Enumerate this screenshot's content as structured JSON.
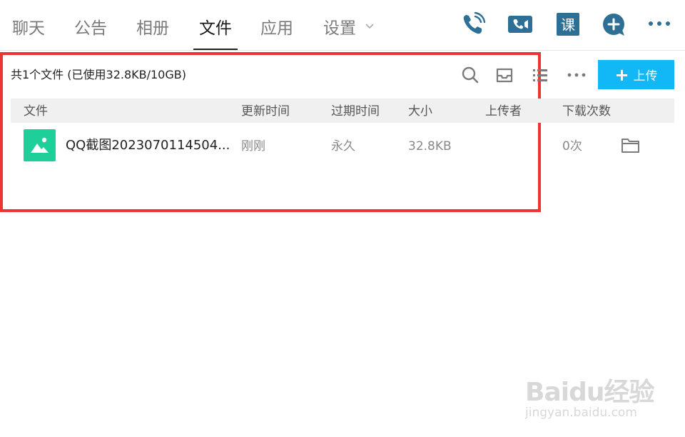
{
  "tabs": [
    {
      "label": "聊天"
    },
    {
      "label": "公告"
    },
    {
      "label": "相册"
    },
    {
      "label": "文件",
      "active": true
    },
    {
      "label": "应用"
    },
    {
      "label": "设置"
    }
  ],
  "toolbar_icons": [
    "phone-call-icon",
    "video-call-icon",
    "course-icon",
    "add-circle-icon",
    "more-icon"
  ],
  "course_icon_char": "课",
  "files": {
    "summary": "共1个文件 (已使用32.8KB/10GB)",
    "upload_label": "上传",
    "columns": [
      "文件",
      "更新时间",
      "过期时间",
      "大小",
      "上传者",
      "下载次数"
    ],
    "rows": [
      {
        "name": "QQ截图2023070114504...",
        "updated": "刚刚",
        "expires": "永久",
        "size": "32.8KB",
        "uploader": "",
        "downloads": "0次"
      }
    ]
  },
  "watermark": {
    "main": "Baidu经验",
    "sub": "jingyan.baidu.com"
  },
  "colors": {
    "accent": "#12b7f5",
    "icon_dark": "#2e6f95",
    "highlight": "#ee3333",
    "file_icon": "#1ecf9a"
  }
}
